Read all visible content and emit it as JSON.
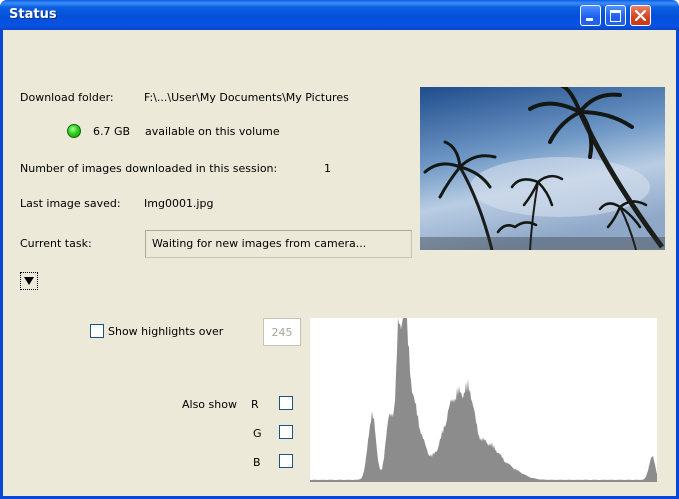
{
  "window": {
    "title": "Status"
  },
  "titlebar_buttons": {
    "minimize": "minimize-icon",
    "maximize": "maximize-icon",
    "close": "close-icon"
  },
  "info": {
    "download_folder_label": "Download folder:",
    "download_folder_value": "F:\\...\\User\\My Documents\\My Pictures",
    "space_value": "6.7 GB",
    "space_suffix": "available on this volume",
    "images_downloaded_label": "Number of images downloaded in this session:",
    "images_downloaded_value": "1",
    "last_image_label": "Last image saved:",
    "last_image_value": "Img0001.jpg",
    "current_task_label": "Current task:",
    "current_task_value": "Waiting for new images from camera..."
  },
  "colors": {
    "status_led": "#2ed01c",
    "histogram_fill": "#8c8c8c",
    "titlebar": "#0a5fe0"
  },
  "expand_button": {
    "icon": "triangle-down-icon"
  },
  "histogram_controls": {
    "show_highlights_label": "Show highlights over",
    "show_highlights_checked": false,
    "threshold_value": "245",
    "also_show_label": "Also show",
    "channels": [
      {
        "label": "R",
        "checked": false
      },
      {
        "label": "G",
        "checked": false
      },
      {
        "label": "B",
        "checked": false
      }
    ]
  }
}
